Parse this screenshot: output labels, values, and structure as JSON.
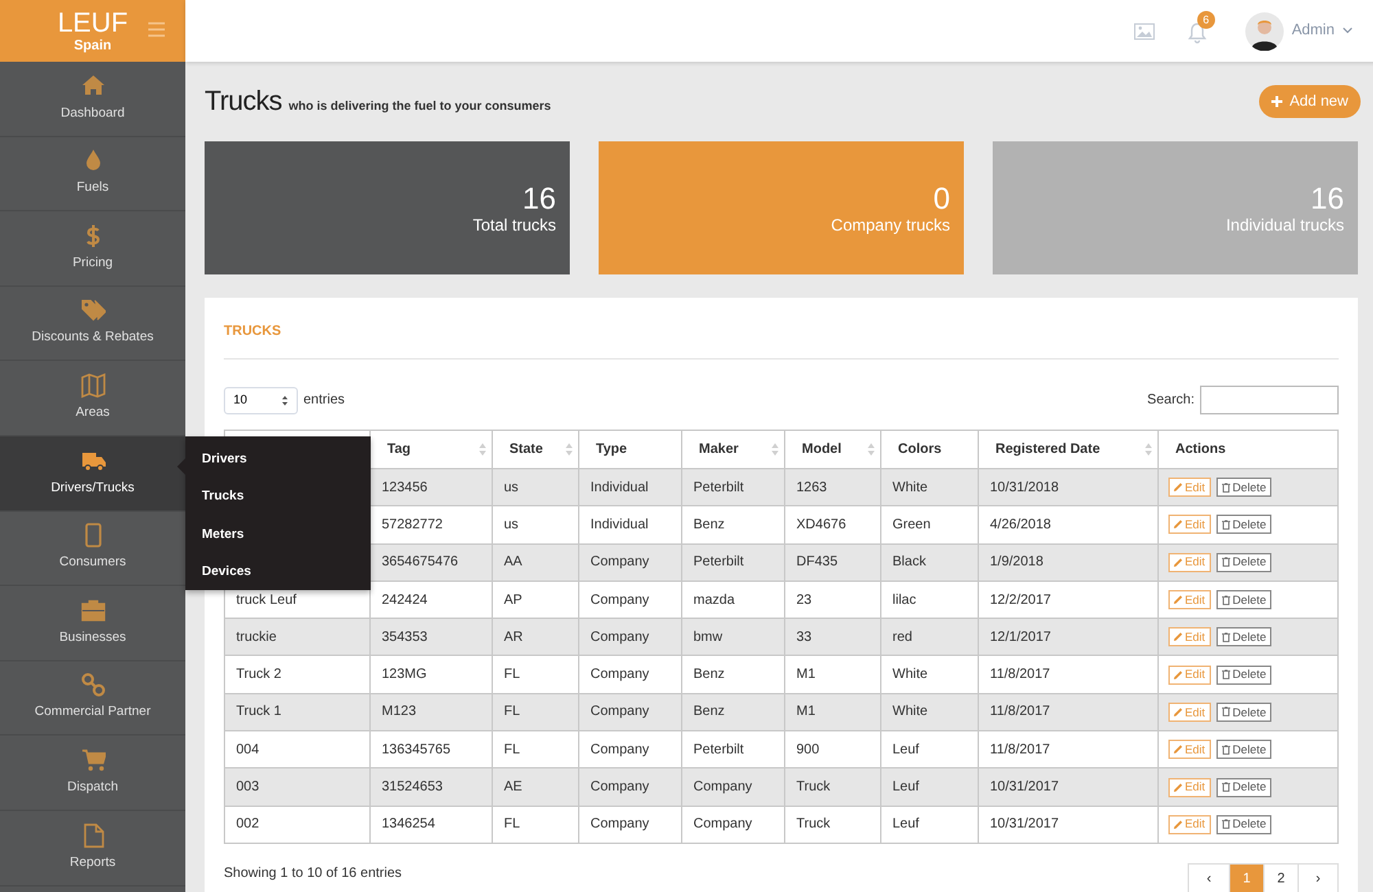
{
  "brand": {
    "name": "LEUF",
    "region": "Spain"
  },
  "topbar": {
    "notifications": "6",
    "user": "Admin"
  },
  "sidebar": {
    "items": [
      {
        "label": "Dashboard",
        "selected": false
      },
      {
        "label": "Fuels",
        "selected": false
      },
      {
        "label": "Pricing",
        "selected": false
      },
      {
        "label": "Discounts & Rebates",
        "selected": false
      },
      {
        "label": "Areas",
        "selected": false
      },
      {
        "label": "Drivers/Trucks",
        "selected": true
      },
      {
        "label": "Consumers",
        "selected": false
      },
      {
        "label": "Businesses",
        "selected": false
      },
      {
        "label": "Commercial Partner",
        "selected": false
      },
      {
        "label": "Dispatch",
        "selected": false
      },
      {
        "label": "Reports",
        "selected": false
      }
    ]
  },
  "submenu": [
    "Drivers",
    "Trucks",
    "Meters",
    "Devices"
  ],
  "page": {
    "title": "Trucks",
    "subtitle": "who is delivering the fuel to your consumers",
    "add_button": "Add new"
  },
  "stats": [
    {
      "value": "16",
      "label": "Total trucks",
      "color": "#555657"
    },
    {
      "value": "0",
      "label": "Company trucks",
      "color": "#e8973c"
    },
    {
      "value": "16",
      "label": "Individual trucks",
      "color": "#b2b2b2"
    }
  ],
  "panel": {
    "title": "TRUCKS",
    "length": "10",
    "length_suffix": "entries",
    "search_label": "Search:",
    "info": "Showing 1 to 10 of 16 entries"
  },
  "table": {
    "columns": [
      {
        "label": "Tag",
        "sortable": true
      },
      {
        "label": "State",
        "sortable": true
      },
      {
        "label": "Type",
        "sortable": false
      },
      {
        "label": "Maker",
        "sortable": true
      },
      {
        "label": "Model",
        "sortable": true
      },
      {
        "label": "Colors",
        "sortable": false
      },
      {
        "label": "Registered Date",
        "sortable": true
      },
      {
        "label": "Actions",
        "sortable": false
      }
    ],
    "rows": [
      {
        "cells": [
          "123456",
          "us",
          "Individual",
          "Peterbilt",
          "1263",
          "White",
          "10/31/2018"
        ],
        "edit": "Edit",
        "delete": "Delete"
      },
      {
        "cells": [
          "57282772",
          "us",
          "Individual",
          "Benz",
          "XD4676",
          "Green",
          "4/26/2018"
        ],
        "edit": "Edit",
        "delete": "Delete"
      },
      {
        "cells": [
          "3654675476",
          "AA",
          "Company",
          "Peterbilt",
          "DF435",
          "Black",
          "1/9/2018"
        ],
        "edit": "Edit",
        "delete": "Delete"
      },
      {
        "column_1": "truck Leuf",
        "cells": [
          "242424",
          "AP",
          "Company",
          "mazda",
          "23",
          "lilac",
          "12/2/2017"
        ],
        "edit": "Edit",
        "delete": "Delete"
      },
      {
        "column_1": "truckie",
        "cells": [
          "354353",
          "AR",
          "Company",
          "bmw",
          "33",
          "red",
          "12/1/2017"
        ],
        "edit": "Edit",
        "delete": "Delete"
      },
      {
        "column_1": "Truck 2",
        "cells": [
          "123MG",
          "FL",
          "Company",
          "Benz",
          "M1",
          "White",
          "11/8/2017"
        ],
        "edit": "Edit",
        "delete": "Delete"
      },
      {
        "column_1": "Truck 1",
        "cells": [
          "M123",
          "FL",
          "Company",
          "Benz",
          "M1",
          "White",
          "11/8/2017"
        ],
        "edit": "Edit",
        "delete": "Delete"
      },
      {
        "column_1": "004",
        "cells": [
          "136345765",
          "FL",
          "Company",
          "Peterbilt",
          "900",
          "Leuf",
          "11/8/2017"
        ],
        "edit": "Edit",
        "delete": "Delete"
      },
      {
        "column_1": "003",
        "cells": [
          "31524653",
          "AE",
          "Company",
          "Company",
          "Truck",
          "Leuf",
          "10/31/2017"
        ],
        "edit": "Edit",
        "delete": "Delete"
      },
      {
        "column_1": "002",
        "cells": [
          "1346254",
          "FL",
          "Company",
          "Company",
          "Truck",
          "Leuf",
          "10/31/2017"
        ],
        "edit": "Edit",
        "delete": "Delete"
      }
    ]
  },
  "pagination": [
    {
      "label": "‹",
      "selected": false
    },
    {
      "label": "1",
      "selected": true
    },
    {
      "label": "2",
      "selected": false
    },
    {
      "label": "›",
      "selected": false
    }
  ]
}
